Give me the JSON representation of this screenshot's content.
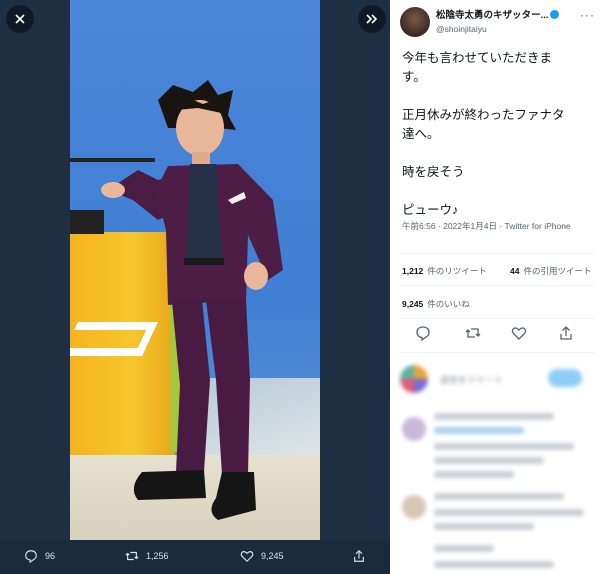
{
  "viewer": {
    "close_icon": "close-icon",
    "expand_icon": "expand-icon",
    "reply_count": "96",
    "retweet_count": "1,256",
    "like_count": "9,245"
  },
  "tweet": {
    "author_name": "松陰寺太勇のキザッター...",
    "handle": "@shoinjitaiyu",
    "lines": [
      "今年も言わせていただきま",
      "す。",
      "",
      "正月休みが終わったファナタ",
      "達へ。",
      "",
      "時を戻そう",
      "",
      "ピューウ♪"
    ],
    "meta": "午前6:56 · 2022年1月4日 · Twitter for iPhone",
    "retweets": {
      "count": "1,212",
      "label": "件のリツイート"
    },
    "quotes": {
      "count": "44",
      "label": "件の引用ツイート"
    },
    "likes": {
      "count": "9,245",
      "label": "件のいいね"
    },
    "reply_prompt": "返信をツイート"
  },
  "colors": {
    "accent": "#1d9bf0",
    "viewer_bg": "#1e2f44",
    "panel_bg": "#ffffff"
  }
}
